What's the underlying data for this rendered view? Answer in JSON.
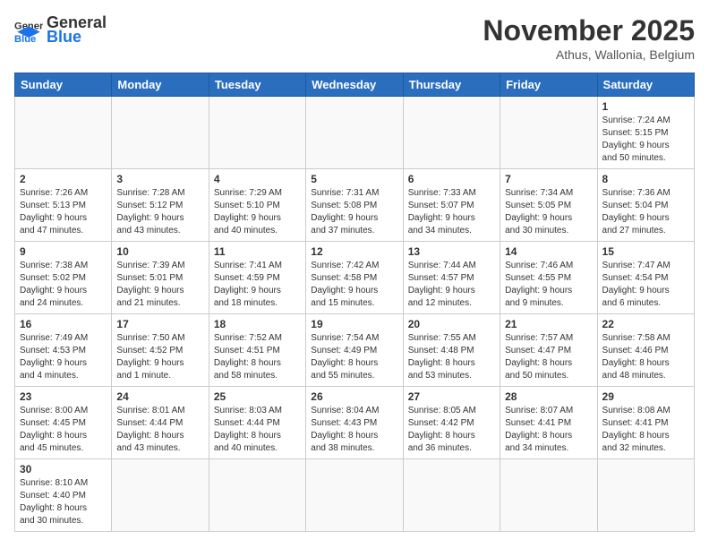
{
  "header": {
    "logo_general": "General",
    "logo_blue": "Blue",
    "month": "November 2025",
    "location": "Athus, Wallonia, Belgium"
  },
  "days_of_week": [
    "Sunday",
    "Monday",
    "Tuesday",
    "Wednesday",
    "Thursday",
    "Friday",
    "Saturday"
  ],
  "weeks": [
    [
      {
        "day": "",
        "info": ""
      },
      {
        "day": "",
        "info": ""
      },
      {
        "day": "",
        "info": ""
      },
      {
        "day": "",
        "info": ""
      },
      {
        "day": "",
        "info": ""
      },
      {
        "day": "",
        "info": ""
      },
      {
        "day": "1",
        "info": "Sunrise: 7:24 AM\nSunset: 5:15 PM\nDaylight: 9 hours\nand 50 minutes."
      }
    ],
    [
      {
        "day": "2",
        "info": "Sunrise: 7:26 AM\nSunset: 5:13 PM\nDaylight: 9 hours\nand 47 minutes."
      },
      {
        "day": "3",
        "info": "Sunrise: 7:28 AM\nSunset: 5:12 PM\nDaylight: 9 hours\nand 43 minutes."
      },
      {
        "day": "4",
        "info": "Sunrise: 7:29 AM\nSunset: 5:10 PM\nDaylight: 9 hours\nand 40 minutes."
      },
      {
        "day": "5",
        "info": "Sunrise: 7:31 AM\nSunset: 5:08 PM\nDaylight: 9 hours\nand 37 minutes."
      },
      {
        "day": "6",
        "info": "Sunrise: 7:33 AM\nSunset: 5:07 PM\nDaylight: 9 hours\nand 34 minutes."
      },
      {
        "day": "7",
        "info": "Sunrise: 7:34 AM\nSunset: 5:05 PM\nDaylight: 9 hours\nand 30 minutes."
      },
      {
        "day": "8",
        "info": "Sunrise: 7:36 AM\nSunset: 5:04 PM\nDaylight: 9 hours\nand 27 minutes."
      }
    ],
    [
      {
        "day": "9",
        "info": "Sunrise: 7:38 AM\nSunset: 5:02 PM\nDaylight: 9 hours\nand 24 minutes."
      },
      {
        "day": "10",
        "info": "Sunrise: 7:39 AM\nSunset: 5:01 PM\nDaylight: 9 hours\nand 21 minutes."
      },
      {
        "day": "11",
        "info": "Sunrise: 7:41 AM\nSunset: 4:59 PM\nDaylight: 9 hours\nand 18 minutes."
      },
      {
        "day": "12",
        "info": "Sunrise: 7:42 AM\nSunset: 4:58 PM\nDaylight: 9 hours\nand 15 minutes."
      },
      {
        "day": "13",
        "info": "Sunrise: 7:44 AM\nSunset: 4:57 PM\nDaylight: 9 hours\nand 12 minutes."
      },
      {
        "day": "14",
        "info": "Sunrise: 7:46 AM\nSunset: 4:55 PM\nDaylight: 9 hours\nand 9 minutes."
      },
      {
        "day": "15",
        "info": "Sunrise: 7:47 AM\nSunset: 4:54 PM\nDaylight: 9 hours\nand 6 minutes."
      }
    ],
    [
      {
        "day": "16",
        "info": "Sunrise: 7:49 AM\nSunset: 4:53 PM\nDaylight: 9 hours\nand 4 minutes."
      },
      {
        "day": "17",
        "info": "Sunrise: 7:50 AM\nSunset: 4:52 PM\nDaylight: 9 hours\nand 1 minute."
      },
      {
        "day": "18",
        "info": "Sunrise: 7:52 AM\nSunset: 4:51 PM\nDaylight: 8 hours\nand 58 minutes."
      },
      {
        "day": "19",
        "info": "Sunrise: 7:54 AM\nSunset: 4:49 PM\nDaylight: 8 hours\nand 55 minutes."
      },
      {
        "day": "20",
        "info": "Sunrise: 7:55 AM\nSunset: 4:48 PM\nDaylight: 8 hours\nand 53 minutes."
      },
      {
        "day": "21",
        "info": "Sunrise: 7:57 AM\nSunset: 4:47 PM\nDaylight: 8 hours\nand 50 minutes."
      },
      {
        "day": "22",
        "info": "Sunrise: 7:58 AM\nSunset: 4:46 PM\nDaylight: 8 hours\nand 48 minutes."
      }
    ],
    [
      {
        "day": "23",
        "info": "Sunrise: 8:00 AM\nSunset: 4:45 PM\nDaylight: 8 hours\nand 45 minutes."
      },
      {
        "day": "24",
        "info": "Sunrise: 8:01 AM\nSunset: 4:44 PM\nDaylight: 8 hours\nand 43 minutes."
      },
      {
        "day": "25",
        "info": "Sunrise: 8:03 AM\nSunset: 4:44 PM\nDaylight: 8 hours\nand 40 minutes."
      },
      {
        "day": "26",
        "info": "Sunrise: 8:04 AM\nSunset: 4:43 PM\nDaylight: 8 hours\nand 38 minutes."
      },
      {
        "day": "27",
        "info": "Sunrise: 8:05 AM\nSunset: 4:42 PM\nDaylight: 8 hours\nand 36 minutes."
      },
      {
        "day": "28",
        "info": "Sunrise: 8:07 AM\nSunset: 4:41 PM\nDaylight: 8 hours\nand 34 minutes."
      },
      {
        "day": "29",
        "info": "Sunrise: 8:08 AM\nSunset: 4:41 PM\nDaylight: 8 hours\nand 32 minutes."
      }
    ],
    [
      {
        "day": "30",
        "info": "Sunrise: 8:10 AM\nSunset: 4:40 PM\nDaylight: 8 hours\nand 30 minutes."
      },
      {
        "day": "",
        "info": ""
      },
      {
        "day": "",
        "info": ""
      },
      {
        "day": "",
        "info": ""
      },
      {
        "day": "",
        "info": ""
      },
      {
        "day": "",
        "info": ""
      },
      {
        "day": "",
        "info": ""
      }
    ]
  ]
}
